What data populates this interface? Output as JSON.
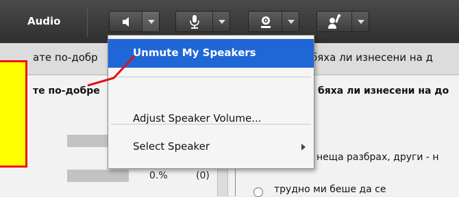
{
  "toolbar": {
    "title": "Audio",
    "buttons": [
      {
        "name": "speaker-button",
        "icon": "speaker-icon"
      },
      {
        "name": "microphone-button",
        "icon": "microphone-icon"
      },
      {
        "name": "webcam-button",
        "icon": "webcam-icon"
      },
      {
        "name": "raise-hand-button",
        "icon": "raise-hand-icon"
      }
    ]
  },
  "background": {
    "question_left_header": "ате по-добр",
    "question_right_header": "бяха ли изнесени на д",
    "question_left_sub": "те по-добре",
    "question_right_sub": "бяха ли изнесени на до",
    "bar_values": [
      {
        "percent": "",
        "count": ""
      },
      {
        "percent": "0.%",
        "count": "(0)"
      }
    ],
    "option_1": "неща разбрах, други - н",
    "option_2": "трудно ми беше да се"
  },
  "menu": {
    "items": [
      {
        "label": "Unmute My Speakers",
        "highlighted": true
      },
      {
        "label": "Adjust Speaker Volume...",
        "highlighted": false
      },
      {
        "label": "Select Speaker",
        "highlighted": false,
        "has_submenu": true
      }
    ]
  },
  "colors": {
    "highlight": "#1f66d6",
    "callout_fill": "#ffff00",
    "callout_border": "#e11111"
  }
}
